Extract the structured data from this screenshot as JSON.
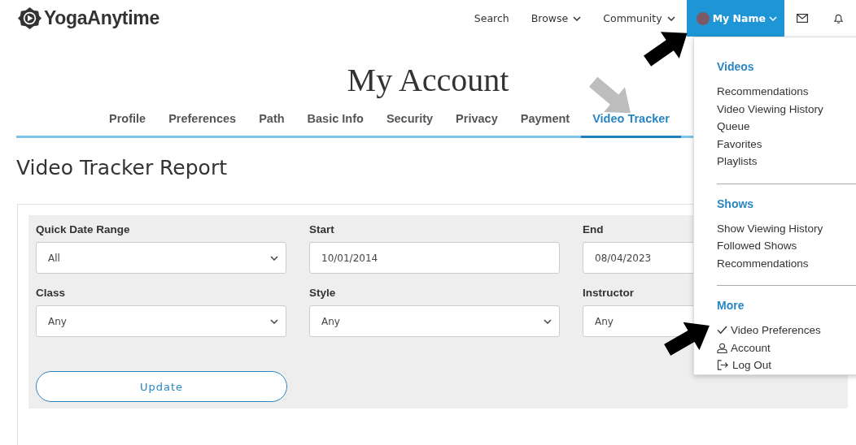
{
  "logo": {
    "text": "YogaAnytime"
  },
  "nav": [
    {
      "label": "Search",
      "kind": "link"
    },
    {
      "label": "Browse",
      "kind": "dropdown"
    },
    {
      "label": "Community",
      "kind": "dropdown"
    }
  ],
  "user_menu": {
    "label": "My Name",
    "expanded": true
  },
  "page_title": "My Account",
  "tabs": [
    {
      "label": "Profile",
      "selected": false
    },
    {
      "label": "Preferences",
      "selected": false
    },
    {
      "label": "Path",
      "selected": false
    },
    {
      "label": "Basic Info",
      "selected": false
    },
    {
      "label": "Security",
      "selected": false
    },
    {
      "label": "Privacy",
      "selected": false
    },
    {
      "label": "Payment",
      "selected": false
    },
    {
      "label": "Video Tracker",
      "selected": true
    }
  ],
  "report_title": "Video Tracker Report",
  "filters": [
    {
      "label": "Quick Date Range",
      "value": "All",
      "caret": true
    },
    {
      "label": "Start",
      "value": "10/01/2014"
    },
    {
      "label": "End",
      "value": "08/04/2023"
    },
    {
      "label": "Class",
      "value": "Any",
      "caret": true
    },
    {
      "label": "Style",
      "value": "Any",
      "caret": true
    },
    {
      "label": "Instructor",
      "value": "Any"
    }
  ],
  "update_button": "Update",
  "dropdown": {
    "sections": [
      {
        "heading": "Videos",
        "items": [
          {
            "label": "Recommendations",
            "kind": "text"
          },
          {
            "label": "Video Viewing History",
            "kind": "text"
          },
          {
            "label": "Queue",
            "kind": "text"
          },
          {
            "label": "Favorites",
            "kind": "text"
          },
          {
            "label": "Playlists",
            "kind": "text"
          }
        ]
      },
      {
        "heading": "Shows",
        "items": [
          {
            "label": "Show Viewing History",
            "kind": "text"
          },
          {
            "label": "Followed Shows",
            "kind": "text"
          },
          {
            "label": "Recommendations",
            "kind": "text"
          }
        ]
      },
      {
        "heading": "More",
        "items": [
          {
            "label": "Video Preferences",
            "kind": "check"
          },
          {
            "label": "Account",
            "kind": "person"
          },
          {
            "label": "Log Out",
            "kind": "logout"
          }
        ]
      }
    ]
  }
}
